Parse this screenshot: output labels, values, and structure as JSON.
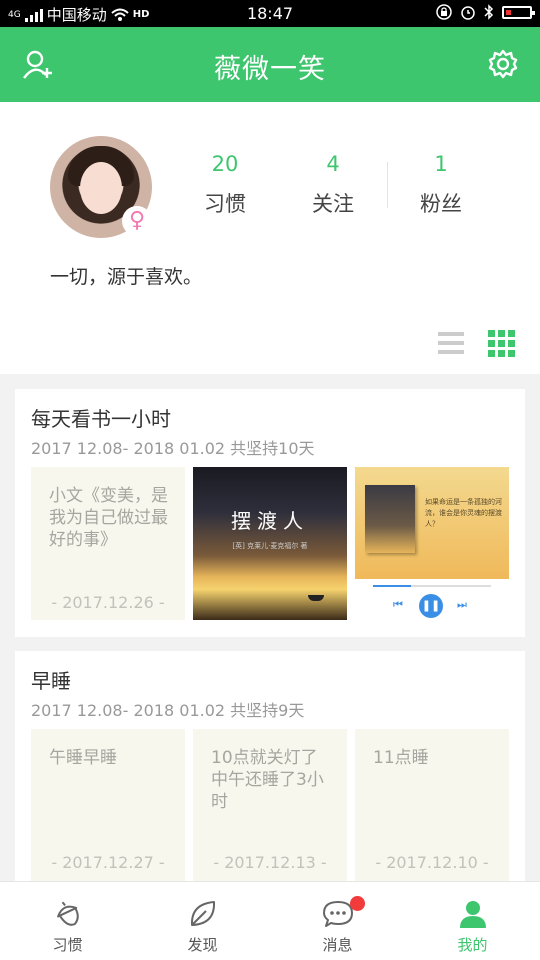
{
  "status_bar": {
    "carrier": "中国移动",
    "time": "18:47",
    "network": "4G",
    "hd": "HD"
  },
  "header": {
    "title": "薇微一笑",
    "left_icon": "add-user-icon",
    "right_icon": "gear-icon"
  },
  "profile": {
    "gender_symbol": "♀",
    "stats": [
      {
        "value": "20",
        "label": "习惯"
      },
      {
        "value": "4",
        "label": "关注"
      },
      {
        "value": "1",
        "label": "粉丝"
      }
    ],
    "bio": "一切，源于喜欢。",
    "accent_color": "#3ec66e"
  },
  "habits": [
    {
      "title": "每天看书一小时",
      "date_range": "2017 12.08- 2018 01.02 共坚持10天",
      "entries": [
        {
          "type": "text",
          "text": "小文《变美，是我为自己做过最好的事》",
          "date": "- 2017.12.26 -"
        },
        {
          "type": "image",
          "caption": "摆渡人"
        },
        {
          "type": "image",
          "caption": "如果命运是一条孤独的河流，谁会是你灵魂的摆渡人？"
        }
      ]
    },
    {
      "title": "早睡",
      "date_range": "2017 12.08- 2018 01.02 共坚持9天",
      "entries": [
        {
          "type": "text",
          "text": "午睡早睡",
          "date": "- 2017.12.27 -"
        },
        {
          "type": "text",
          "text": "10点就关灯了 中午还睡了3小时",
          "date": "- 2017.12.13 -"
        },
        {
          "type": "text",
          "text": "11点睡",
          "date": "- 2017.12.10 -"
        }
      ]
    }
  ],
  "tabbar": {
    "tabs": [
      {
        "label": "习惯",
        "icon": "acorn-icon"
      },
      {
        "label": "发现",
        "icon": "leaf-icon"
      },
      {
        "label": "消息",
        "icon": "chat-icon"
      },
      {
        "label": "我的",
        "icon": "person-icon",
        "active": true
      }
    ]
  }
}
